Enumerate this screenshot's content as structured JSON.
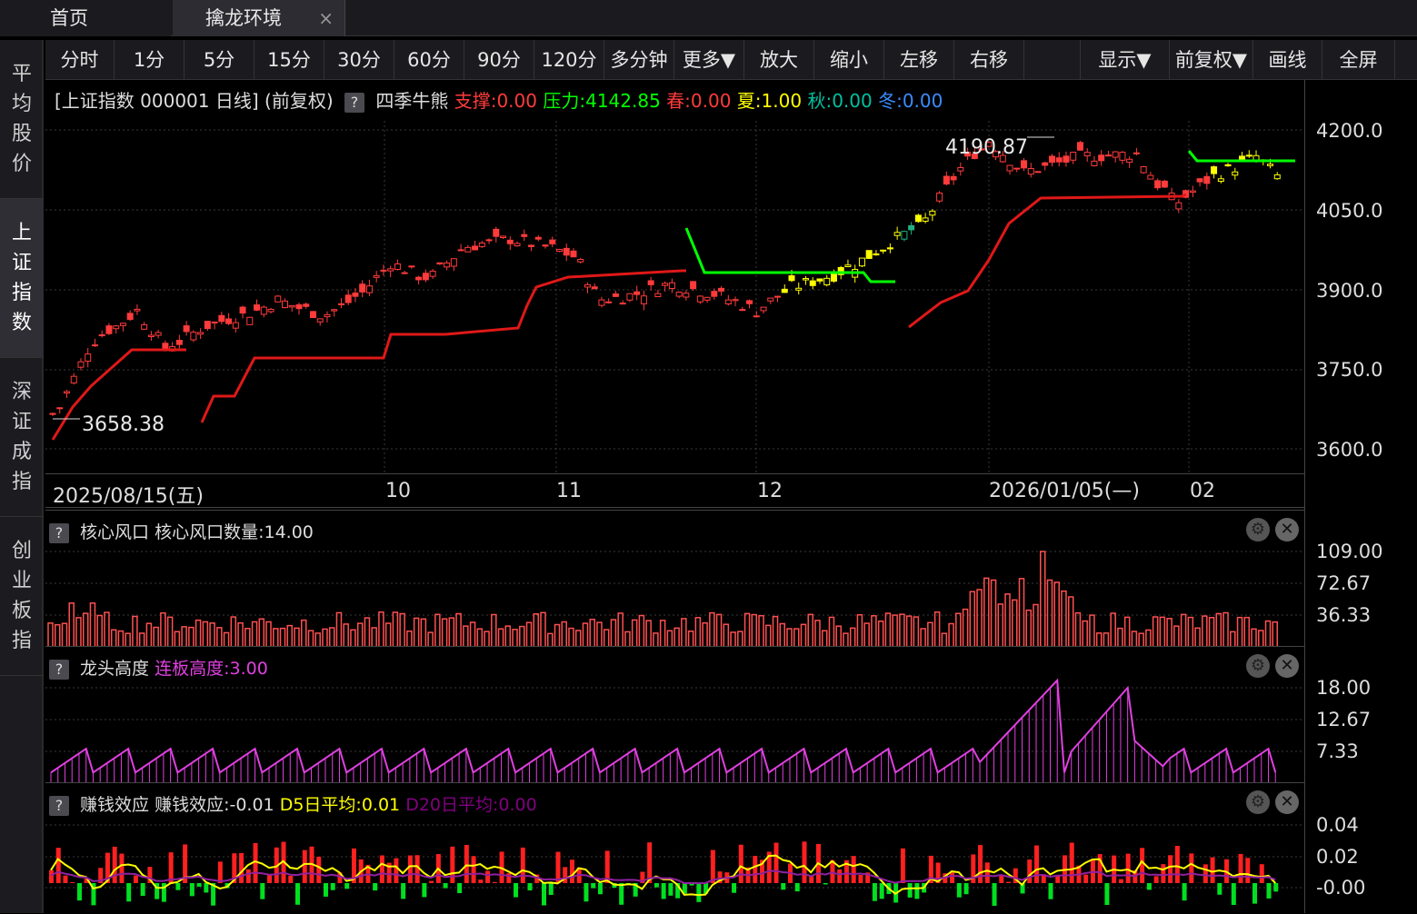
{
  "tabs": {
    "home": "首页",
    "env": "擒龙环境",
    "close": "×"
  },
  "sidebar": [
    "平均股价",
    "上证指数",
    "深证成指",
    "创业板指"
  ],
  "toolbar": [
    "分时",
    "1分",
    "5分",
    "15分",
    "30分",
    "60分",
    "90分",
    "120分",
    "多分钟",
    "更多▼",
    "放大",
    "缩小",
    "左移",
    "右移",
    "",
    "显示▼",
    "前复权▼",
    "画线",
    "全屏"
  ],
  "main": {
    "title": "[上证指数 000001 日线]  (前复权)",
    "q": "?",
    "indicator": "四季牛熊",
    "support": "支撑:0.00",
    "pressure": "压力:4142.85",
    "spring": "春:0.00",
    "summer": "夏:1.00",
    "autumn": "秋:0.00",
    "winter": "冬:0.00",
    "high_label": "4190.87",
    "low_label": "3658.38",
    "y_ticks": [
      "4200.0",
      "4050.0",
      "3900.0",
      "3750.0",
      "3600.0"
    ]
  },
  "dates": [
    "2025/08/15(五)",
    "10",
    "11",
    "12",
    "2026/01/05(—)",
    "02"
  ],
  "core": {
    "title": "核心风口  核心风口数量:14.00",
    "ticks": [
      "109.00",
      "72.67",
      "36.33"
    ]
  },
  "dragon": {
    "title": "龙头高度",
    "value": "连板高度:3.00",
    "ticks": [
      "18.00",
      "12.67",
      "7.33"
    ]
  },
  "profit": {
    "title": "赚钱效应  赚钱效应:-0.01",
    "d5": "D5日平均:0.01",
    "d20": "D20日平均:0.00",
    "ticks": [
      "0.04",
      "0.02",
      "-0.00"
    ]
  },
  "colors": {
    "up": "#ff3b3b",
    "down": "#00c0c0",
    "yellow": "#ffff00",
    "green": "#00ff00",
    "magenta": "#e040e0"
  }
}
